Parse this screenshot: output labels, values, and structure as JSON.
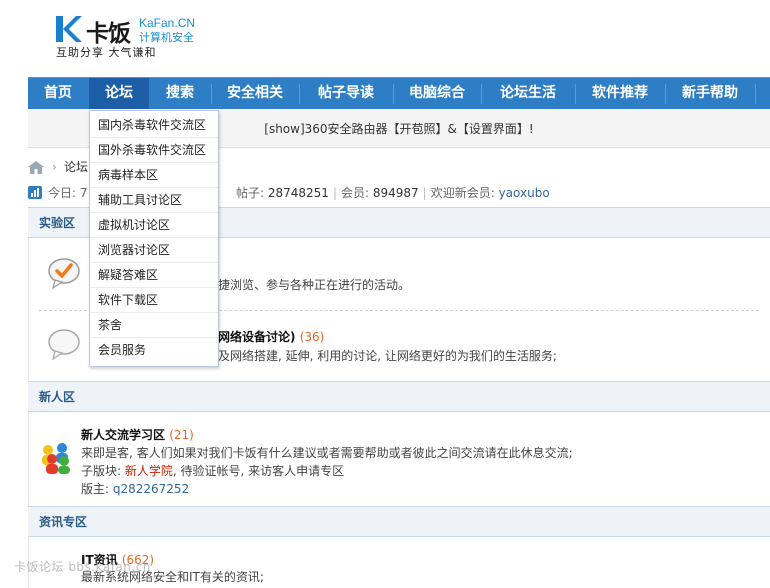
{
  "logo": {
    "brand_cn": "卡饭",
    "brand_en": "KaFan.CN",
    "tagline": "计算机安全",
    "motto": "互助分享  大气谦和"
  },
  "nav": {
    "items": [
      {
        "label": "首页"
      },
      {
        "label": "论坛"
      },
      {
        "label": "搜索"
      },
      {
        "label": "安全相关"
      },
      {
        "label": "帖子导读"
      },
      {
        "label": "电脑综合"
      },
      {
        "label": "论坛生活"
      },
      {
        "label": "软件推荐"
      },
      {
        "label": "新手帮助"
      }
    ]
  },
  "notice": {
    "text": "[show]360安全路由器【开苞照】&【设置界面】!"
  },
  "breadcrumb": {
    "text": "论坛"
  },
  "stats": {
    "today_label": "今日: 7",
    "posts_label": "帖子: ",
    "posts_value": "28748251",
    "members_label": "会员: ",
    "members_value": "894987",
    "welcome_label": "欢迎新会员: ",
    "newest_member": "yaoxubo"
  },
  "dropdown": {
    "items": [
      "国内杀毒软件交流区",
      "国外杀毒软件交流区",
      "病毒样本区",
      "辅助工具讨论区",
      "虚拟机讨论区",
      "浏览器讨论区",
      "解疑答难区",
      "软件下载区",
      "茶舍",
      "会员服务"
    ]
  },
  "sections": {
    "lab": {
      "title": "实验区",
      "forum1_desc": "捷浏览、参与各种正在进行的活动。",
      "forum2_name": "网络设备讨论)",
      "forum2_count": "(36)",
      "forum2_desc": "及网络搭建, 延伸, 利用的讨论, 让网络更好的为我们的生活服务;"
    },
    "newbie": {
      "title": "新人区",
      "forum_name": "新人交流学习区",
      "forum_count": "(21)",
      "desc": "来即是客, 客人们如果对我们卡饭有什么建议或者需要帮助或者彼此之间交流请在此休息交流;",
      "sub_label": "子版块: ",
      "sub_link": "新人学院",
      "sub_rest": ", 待验证帐号, 来访客人申请专区",
      "mod_label": "版主: ",
      "mod_name": "q282267252"
    },
    "news": {
      "title": "资讯专区",
      "forum_name": "IT资讯",
      "forum_count": "(662)",
      "desc": "最新系统网络安全和IT有关的资讯;"
    }
  },
  "watermark": {
    "text": "卡饭论坛 bbs.kafan.cn"
  },
  "colors": {
    "nav_bg": "#2d7ec5",
    "nav_active": "#1d5fa6",
    "accent_blue": "#1a8fd1",
    "count_orange": "#e06a2a"
  }
}
